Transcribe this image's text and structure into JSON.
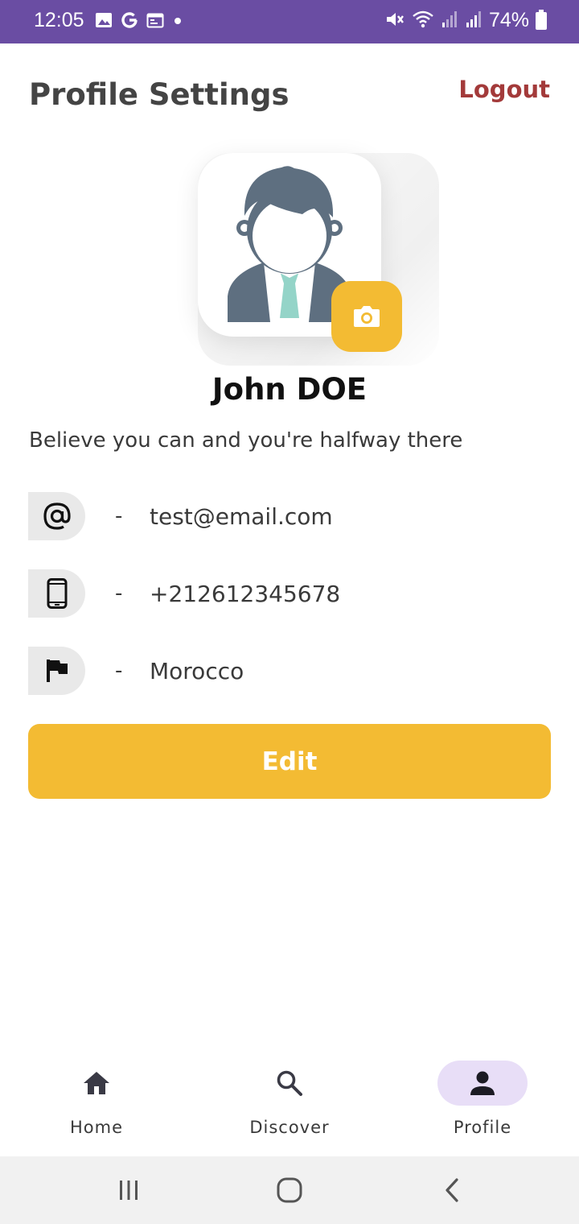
{
  "status_bar": {
    "time": "12:05",
    "battery": "74%",
    "background": "#6a4da3",
    "left_icons": [
      "gallery-icon",
      "google-icon",
      "calendar-icon",
      "dot-icon"
    ],
    "right_icons": [
      "mute-icon",
      "wifi-icon",
      "signal-icon",
      "signal-icon",
      "battery-icon"
    ]
  },
  "header": {
    "title": "Profile Settings",
    "logout_label": "Logout"
  },
  "profile": {
    "avatar_icon": "person-avatar-icon",
    "camera_icon": "camera-icon",
    "name": "John DOE",
    "bio": "Believe you can and you're halfway there"
  },
  "info": {
    "separator": "-",
    "items": [
      {
        "icon": "at-sign-icon",
        "value": "test@email.com"
      },
      {
        "icon": "phone-icon",
        "value": "+212612345678"
      },
      {
        "icon": "flag-icon",
        "value": "Morocco"
      }
    ]
  },
  "edit_label": "Edit",
  "bottom_nav": {
    "items": [
      {
        "icon": "home-icon",
        "label": "Home",
        "active": false
      },
      {
        "icon": "search-icon",
        "label": "Discover",
        "active": false
      },
      {
        "icon": "person-icon",
        "label": "Profile",
        "active": true
      }
    ]
  },
  "system_nav": [
    "recents-icon",
    "home-circle-icon",
    "back-icon"
  ],
  "colors": {
    "accent": "#f3bb33",
    "logout": "#a33a3a",
    "active_pill": "#e8def7",
    "avatar": "#5e6f80",
    "tie": "#94d4c8"
  }
}
